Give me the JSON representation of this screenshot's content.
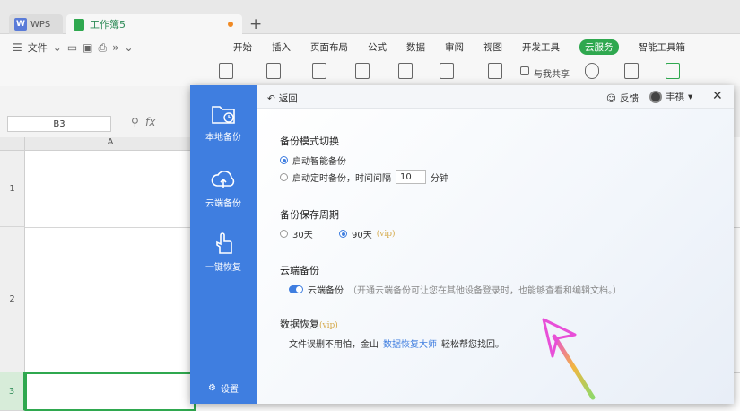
{
  "tabs": {
    "wps_label": "WPS",
    "doc_label": "工作簿5"
  },
  "menu": {
    "file": "文件",
    "ribbon": [
      "开始",
      "插入",
      "页面布局",
      "公式",
      "数据",
      "审阅",
      "视图",
      "开发工具",
      "云服务",
      "智能工具箱"
    ],
    "active_ribbon": "云服务",
    "share_label": "与我共享"
  },
  "formula": {
    "cell_ref": "B3",
    "fx": "fx"
  },
  "grid": {
    "column_a": "A",
    "rows": [
      "1",
      "2",
      "3"
    ]
  },
  "dialog": {
    "sidebar": {
      "local_backup": "本地备份",
      "cloud_backup": "云端备份",
      "restore": "一键恢复",
      "settings": "设置"
    },
    "back": "返回",
    "feedback": "反馈",
    "user": "丰祺",
    "mode_title": "备份模式切换",
    "smart_backup": "启动智能备份",
    "timed_backup": "启动定时备份，时间间隔",
    "interval_value": "10",
    "interval_unit": "分钟",
    "period_title": "备份保存周期",
    "period_30": "30天",
    "period_90": "90天",
    "vip": "(vip)",
    "cloud_title": "云端备份",
    "cloud_toggle_label": "云端备份",
    "cloud_hint": "（开通云端备份可让您在其他设备登录时，也能够查看和编辑文档。）",
    "recovery_title": "数据恢复",
    "recovery_text_pre": "文件误删不用怕，金山",
    "recovery_link": "数据恢复大师",
    "recovery_text_post": "轻松帮您找回。"
  },
  "colors": {
    "accent": "#3f7ee0",
    "brand_green": "#2fa84f"
  }
}
